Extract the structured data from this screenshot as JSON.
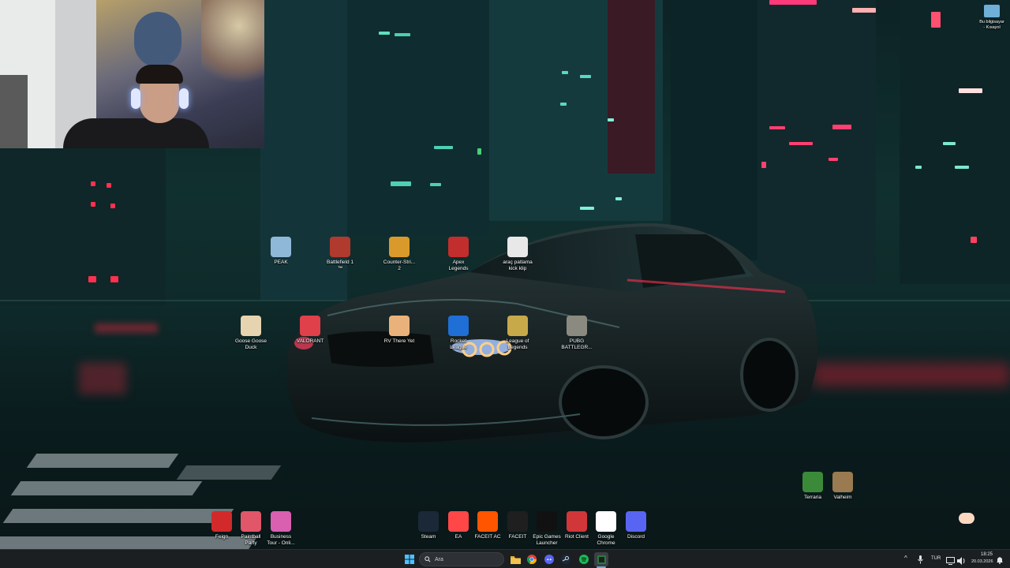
{
  "desktop": {
    "icons": [
      {
        "label": "PEAK",
        "icon": "peak-icon",
        "color": "#8fb8d8"
      },
      {
        "label": "Battlefield 1\n™",
        "icon": "battlefield-icon",
        "color": "#b03a2e"
      },
      {
        "label": "Counter-Stri...\n2",
        "icon": "cs2-icon",
        "color": "#d99a2b"
      },
      {
        "label": "Apex\nLegends",
        "icon": "apex-icon",
        "color": "#c22d2d"
      },
      {
        "label": "araç patlama\nkick klip",
        "icon": "video-file-icon",
        "color": "#e8e8e8"
      },
      {
        "label": "Goose Goose\nDuck",
        "icon": "goose-icon",
        "color": "#e6d4b0"
      },
      {
        "label": "VALORANT",
        "icon": "valorant-icon",
        "color": "#e0404a"
      },
      {
        "label": "RV There Yet",
        "icon": "rv-icon",
        "color": "#e9b27a"
      },
      {
        "label": "Rocket\nLeague",
        "icon": "rocket-league-icon",
        "color": "#1f6fd6"
      },
      {
        "label": "League of\nLegends",
        "icon": "lol-icon",
        "color": "#c8a94a"
      },
      {
        "label": "PUBG\nBATTLEGR...",
        "icon": "pubg-icon",
        "color": "#8a8a80"
      },
      {
        "label": "Terraria",
        "icon": "terraria-icon",
        "color": "#3a8a3a"
      },
      {
        "label": "Valheim",
        "icon": "valheim-icon",
        "color": "#9a7a50"
      },
      {
        "label": "Feign",
        "icon": "feign-icon",
        "color": "#d22a2a"
      },
      {
        "label": "Paintball\nParty",
        "icon": "paintball-icon",
        "color": "#e2566a"
      },
      {
        "label": "Business\nTour - Onli...",
        "icon": "business-tour-icon",
        "color": "#d95fb0"
      },
      {
        "label": "Steam",
        "icon": "steam-icon",
        "color": "#1b2838"
      },
      {
        "label": "EA",
        "icon": "ea-icon",
        "color": "#ff4747"
      },
      {
        "label": "FACEIT AC",
        "icon": "faceit-ac-icon",
        "color": "#ff5500"
      },
      {
        "label": "FACEIT",
        "icon": "faceit-icon",
        "color": "#1f1f1f"
      },
      {
        "label": "Epic Games\nLauncher",
        "icon": "epic-games-icon",
        "color": "#111111"
      },
      {
        "label": "Riot Client",
        "icon": "riot-client-icon",
        "color": "#d13639"
      },
      {
        "label": "Google\nChrome",
        "icon": "chrome-icon",
        "color": "#ffffff"
      },
      {
        "label": "Discord",
        "icon": "discord-icon",
        "color": "#5865f2"
      }
    ],
    "this_pc": {
      "label": "Bu bilgisayar\n- Kısayol",
      "icon": "this-pc-icon"
    }
  },
  "taskbar": {
    "search_placeholder": "Ara",
    "language": "TUR",
    "time": "18:25",
    "date": "20.03.2026",
    "apps": [
      "start-icon",
      "file-explorer-icon",
      "chrome-icon",
      "discord-icon",
      "steam-icon",
      "spotify-icon",
      "terminal-icon"
    ]
  }
}
